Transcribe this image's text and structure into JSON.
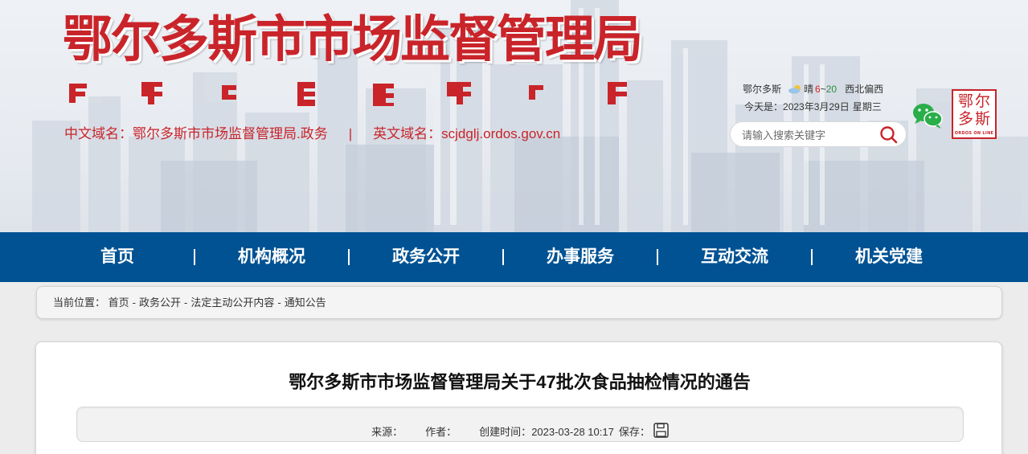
{
  "header": {
    "site_title": "鄂尔多斯市市场监督管理局",
    "cn_domain_label": "中文域名：鄂尔多斯市市场监督管理局.政务",
    "separator": "|",
    "en_domain_label": "英文域名：scjdglj.ordos.gov.cn",
    "logo_text": "鄂尔多斯",
    "logo_subtext": "ORDOS ON LINE"
  },
  "weather": {
    "city": "鄂尔多斯",
    "condition": "晴",
    "temp_low": "6",
    "temp_sep": "~",
    "temp_high": "20",
    "wind": "西北偏西",
    "today_label": "今天是：",
    "date": "2023年3月29日",
    "weekday": "星期三"
  },
  "search": {
    "placeholder": "请输入搜索关键字"
  },
  "nav": {
    "items": [
      "首页",
      "机构概况",
      "政务公开",
      "办事服务",
      "互动交流",
      "机关党建"
    ]
  },
  "breadcrumb": {
    "prefix": "当前位置：",
    "items": [
      "首页",
      "政务公开",
      "法定主动公开内容",
      "通知公告"
    ],
    "separator": "-"
  },
  "article": {
    "title": "鄂尔多斯市市场监督管理局关于47批次食品抽检情况的通告",
    "source_label": "来源：",
    "author_label": "作者：",
    "created_label": "创建时间：",
    "created_value": "2023-03-28 10:17",
    "save_label": "保存："
  },
  "colors": {
    "brand_red": "#c9242a",
    "nav_blue": "#005293",
    "temp_high_green": "#2e8b3c"
  },
  "icons": [
    "search-icon",
    "wechat-icon",
    "save-icon",
    "cloud-sun-icon"
  ]
}
